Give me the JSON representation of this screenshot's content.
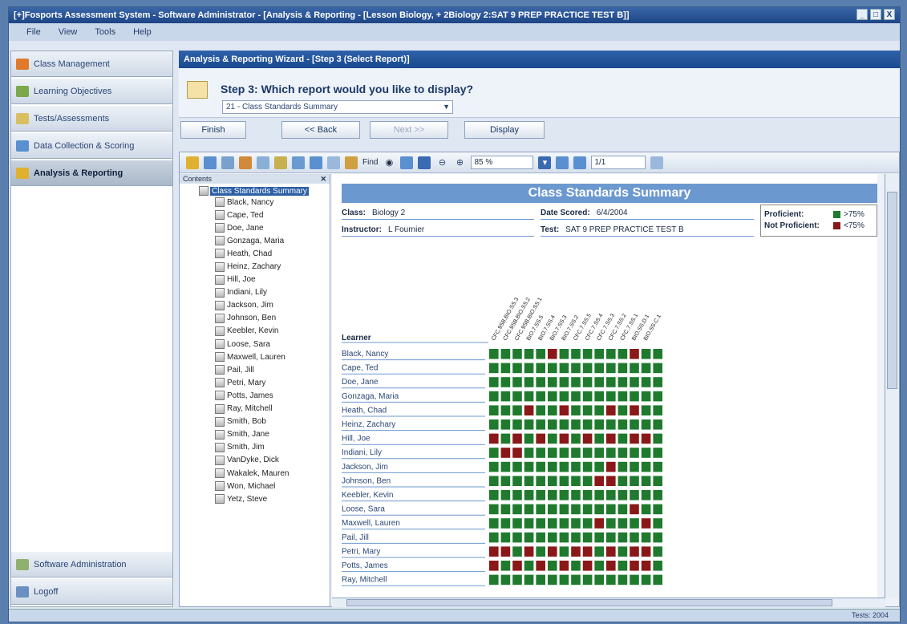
{
  "window": {
    "title": "[+]Fosports Assessment System - Software Administrator - [Analysis & Reporting - [Lesson Biology, + 2Biology 2:SAT 9 PREP PRACTICE TEST B]]",
    "btns": [
      "_",
      "□",
      "X"
    ]
  },
  "menu": [
    "File",
    "View",
    "Tools",
    "Help"
  ],
  "sidebar": {
    "items": [
      {
        "label": "Class Management",
        "color": "#e07a2a"
      },
      {
        "label": "Learning Objectives",
        "color": "#7aa84a"
      },
      {
        "label": "Tests/Assessments",
        "color": "#d8c060"
      },
      {
        "label": "Data Collection & Scoring",
        "color": "#5a8fd0"
      },
      {
        "label": "Analysis & Reporting",
        "color": "#e0b030"
      }
    ],
    "bottom": [
      {
        "label": "Software Administration",
        "color": "#90b070"
      },
      {
        "label": "Logoff",
        "color": "#6a8fc0"
      }
    ]
  },
  "wizard": {
    "header": "Analysis & Reporting Wizard - [Step 3 (Select Report)]",
    "step_title": "Step 3: Which report would you like to display?",
    "report_value": "21 - Class Standards Summary",
    "buttons": {
      "finish": "Finish",
      "back": "<< Back",
      "next": "Next >>",
      "display": "Display"
    }
  },
  "toolbar": {
    "zoom": "85 %",
    "page": "1/1",
    "find": "Find"
  },
  "tree": {
    "header": "Contents",
    "root": "Class Standards Summary",
    "students": [
      "Black, Nancy",
      "Cape, Ted",
      "Doe, Jane",
      "Gonzaga, Maria",
      "Heath, Chad",
      "Heinz, Zachary",
      "Hill, Joe",
      "Indiani, Lily",
      "Jackson, Jim",
      "Johnson, Ben",
      "Keebler, Kevin",
      "Loose, Sara",
      "Maxwell, Lauren",
      "Pail, Jill",
      "Petri, Mary",
      "Potts, James",
      "Ray, Mitchell",
      "Smith, Bob",
      "Smith, Jane",
      "Smith, Jim",
      "VanDyke, Dick",
      "Wakalek, Mauren",
      "Won, Michael",
      "Yetz, Steve"
    ]
  },
  "report": {
    "title": "Class Standards Summary",
    "class_label": "Class:",
    "class": "Biology 2",
    "instructor_label": "Instructor:",
    "instructor": "L Fournier",
    "date_label": "Date Scored:",
    "date": "6/4/2004",
    "test_label": "Test:",
    "test": "SAT 9 PREP PRACTICE TEST B",
    "legend": {
      "proficient": "Proficient:",
      "proficient_val": ">75%",
      "not_proficient": "Not Proficient:",
      "not_proficient_val": "<75%",
      "colors": {
        "proficient": "#1f7a2e",
        "not_proficient": "#8a1818"
      }
    },
    "learner_header": "Learner",
    "standards": [
      "CFC.9SB.BIO.SS.3",
      "CFC.9SB.BIO.SS.2",
      "CFC.9SB.BIO.SS.1",
      "BIO.7.SS.5",
      "BIO.7.SS.4",
      "BIO.7.SS.3",
      "BIO.7.SS.2",
      "CFC.7.SS.5",
      "CFC.7.SS.4",
      "CFC.7.SS.3",
      "CFC.7.SS.2",
      "CFC.7.SS.1",
      "BIO.SS.D.1",
      "BIO.SS.C.1"
    ],
    "learners": [
      "Black, Nancy",
      "Cape, Ted",
      "Doe, Jane",
      "Gonzaga, Maria",
      "Heath, Chad",
      "Heinz, Zachary",
      "Hill, Joe",
      "Indiani, Lily",
      "Jackson, Jim",
      "Johnson, Ben",
      "Keebler, Kevin",
      "Loose, Sara",
      "Maxwell, Lauren",
      "Pail, Jill",
      "Petri, Mary",
      "Potts, James",
      "Ray, Mitchell"
    ],
    "grid": [
      "PPPPPNPPPPPPNPP",
      "PPPPPPPPPPPPPPP",
      "PPPPPPPPPPPPPPP",
      "PPPPPPPPPPPPPPP",
      "PPPNPPNPPPNPNPP",
      "PPPPPPPPPPPPPPP",
      "NPNPNPNPNPNPNNP",
      "PNNPPPPPPPPPPPP",
      "PPPPPPPPPPNPPPP",
      "PPPPPPPPPNNPPPP",
      "PPPPPPPPPPPPPPP",
      "PPPPPPPPPPPPNPP",
      "PPPPPPPPPNPPPNP",
      "PPPPPPPPPPPPPPP",
      "NNPNPNPNNPNPNNP",
      "NPNPNPNPNPNPNNP",
      "PPPPPPPPPPPPPPP"
    ]
  },
  "status": {
    "text": "Tests: 2004"
  }
}
